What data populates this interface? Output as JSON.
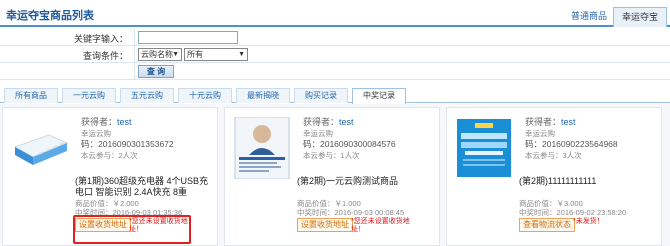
{
  "header": {
    "title": "幸运夺宝商品列表",
    "tabs": [
      {
        "label": "普通商品",
        "active": false
      },
      {
        "label": "幸运夺宝",
        "active": true
      }
    ]
  },
  "search": {
    "keyword_label": "关键字输入：",
    "keyword_value": "",
    "condition_label": "查询条件：",
    "select1": "云购名称",
    "select2": "所有",
    "query_button": "查 询"
  },
  "filter_tabs": [
    {
      "label": "所有商品",
      "active": false
    },
    {
      "label": "一元云购",
      "active": false
    },
    {
      "label": "五元云购",
      "active": false
    },
    {
      "label": "十元云购",
      "active": false
    },
    {
      "label": "最新揭晓",
      "active": false
    },
    {
      "label": "购买记录",
      "active": false
    },
    {
      "label": "中奖记录",
      "active": true
    }
  ],
  "cards": [
    {
      "winner_label": "获得者：",
      "winner_name": "test",
      "platform": "幸运云购",
      "code": "码：2016090301353672",
      "participation": "本云参与：2人次",
      "title": "(第1期)360超级充电器 4个USB充电口 智能识别 2.4A快充 8重",
      "price": "商品价值：￥2.000",
      "time": "中奖时间：2016-09-03 01:35:36",
      "action": "设置收货地址",
      "warning": "*您还未设置收货地址！"
    },
    {
      "winner_label": "获得者：",
      "winner_name": "test",
      "platform": "幸运云购",
      "code": "码：2016090300084576",
      "participation": "本云参与：1人次",
      "title": "(第2期)一元云购测试商品",
      "price": "商品价值：￥1.000",
      "time": "中奖时间：2016-09-03 00:08:45",
      "action": "设置收货地址",
      "warning": "*您还未设置收货地址！"
    },
    {
      "winner_label": "获得者：",
      "winner_name": "test",
      "platform": "幸运云购",
      "code": "码：2016090223564968",
      "participation": "本云参与：3人次",
      "title": "(第2期)11111111111",
      "price": "商品价值：￥3.000",
      "time": "中奖时间：2016-09-02 23:58:20",
      "action": "查看物流状态",
      "warning": "*未发货！"
    }
  ],
  "colors": {
    "accent": "#1f66b0",
    "warning": "#e01010",
    "action_border": "#f0a050"
  }
}
